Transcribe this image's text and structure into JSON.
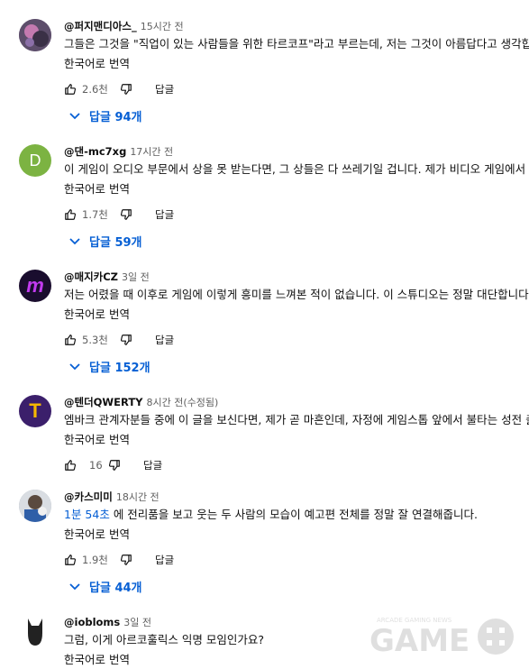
{
  "comments": [
    {
      "author": "@퍼지맨디아스_",
      "time": "15시간 전",
      "text": "그들은 그것을 \"직업이 있는 사람들을 위한 타르코프\"라고 부르는데, 저는 그것이 아름답다고 생각합니",
      "translate": "한국어로 번역",
      "likes": "2.6천",
      "reply": "답글",
      "replies": "답글 94개",
      "avatar_color": "#7a6a8a"
    },
    {
      "author": "@댄-mc7xg",
      "time": "17시간 전",
      "text": "이 게임이 오디오 부문에서 상을 못 받는다면, 그 상들은 다 쓰레기일 겁니다. 제가 비디오 게임에서 들",
      "translate": "한국어로 번역",
      "likes": "1.7천",
      "reply": "답글",
      "replies": "답글 59개",
      "avatar_letter": "D",
      "avatar_color": "#7cb342"
    },
    {
      "author": "@매지카CZ",
      "time": "3일 전",
      "text": "저는 어렸을 때 이후로 게임에 이렇게 흥미를 느껴본 적이 없습니다. 이 스튜디오는 정말 대단합니다.",
      "translate": "한국어로 번역",
      "likes": "5.3천",
      "reply": "답글",
      "replies": "답글 152개",
      "avatar_letter": "m",
      "avatar_color": "#1a0d2e"
    },
    {
      "author": "@텐더QWERTY",
      "time": "8시간 전(수정됨)",
      "text": "엠바크 관계자분들 중에 이 글을 보신다면, 제가 곧 마흔인데, 자정에 게임스톱 앞에서 불타는 성전 출시",
      "translate": "한국어로 번역",
      "likes": "16",
      "reply": "답글",
      "avatar_letter": "T",
      "avatar_color": "#3b1f6b"
    },
    {
      "author": "@카스미미",
      "time": "18시간 전",
      "timestamp": "1분 54초",
      "text": " 에 전리품을 보고 웃는 두 사람의 모습이 예고편 전체를 정말 잘 연결해줍니다.",
      "translate": "한국어로 번역",
      "likes": "1.9천",
      "reply": "답글",
      "replies": "답글 44개",
      "avatar_color": "#9aa4b0"
    },
    {
      "author": "@iobloms",
      "time": "3일 전",
      "text": "그럼, 이게 아르코훌릭스 익명 모임인가요?",
      "translate": "한국어로 번역",
      "avatar_color": "#222222"
    }
  ],
  "watermark": {
    "line1": "GAME",
    "line2": "ARCADE GAMING NEWS"
  }
}
